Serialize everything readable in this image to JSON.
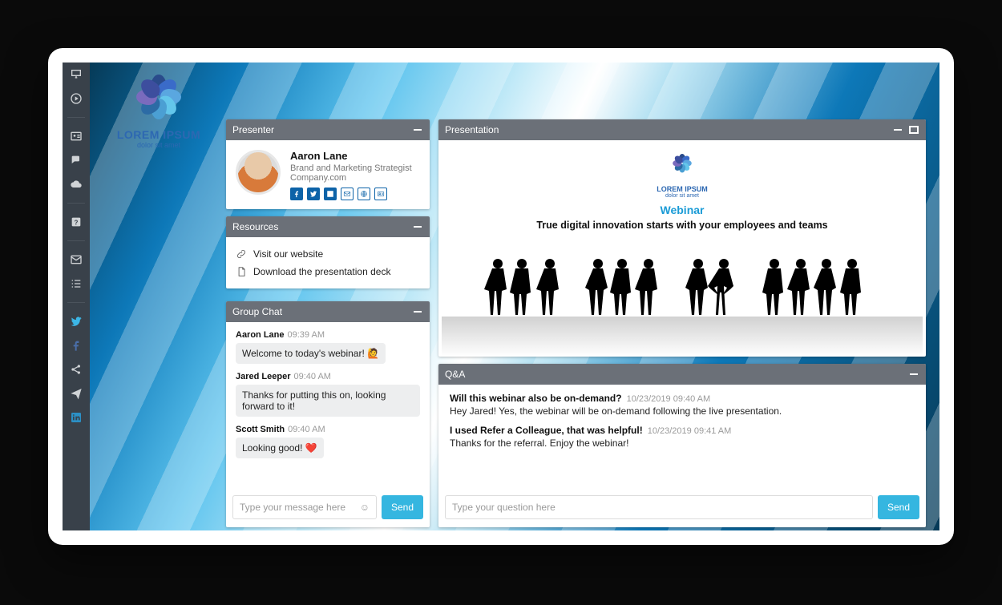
{
  "brand": {
    "title": "LOREM IPSUM",
    "tagline": "dolor sit amet"
  },
  "panels": {
    "presenter": "Presenter",
    "resources": "Resources",
    "chat": "Group Chat",
    "presentation": "Presentation",
    "qa": "Q&A"
  },
  "presenter": {
    "name": "Aaron Lane",
    "role": "Brand and Marketing Strategist",
    "company": "Company.com"
  },
  "resources": {
    "items": [
      {
        "label": "Visit our website"
      },
      {
        "label": "Download the presentation deck"
      }
    ]
  },
  "chat": {
    "messages": [
      {
        "author": "Aaron Lane",
        "time": "09:39 AM",
        "text": "Welcome to today's webinar! 🙋"
      },
      {
        "author": "Jared Leeper",
        "time": "09:40 AM",
        "text": "Thanks for putting this on, looking forward to it!"
      },
      {
        "author": "Scott Smith",
        "time": "09:40 AM",
        "text": "Looking good! ❤️"
      }
    ],
    "placeholder": "Type your message here",
    "send": "Send"
  },
  "presentation": {
    "logo_title": "LOREM IPSUM",
    "logo_sub": "dolor sit amet",
    "label": "Webinar",
    "headline": "True digital innovation starts with your employees and teams"
  },
  "qa": {
    "items": [
      {
        "question": "Will this webinar also be on-demand?",
        "time": "10/23/2019 09:40 AM",
        "answer": "Hey Jared! Yes, the webinar will be on-demand following the live presentation."
      },
      {
        "question": "I used Refer a Colleague, that was helpful!",
        "time": "10/23/2019 09:41 AM",
        "answer": "Thanks for the referral. Enjoy the webinar!"
      }
    ],
    "placeholder": "Type your question here",
    "send": "Send"
  }
}
